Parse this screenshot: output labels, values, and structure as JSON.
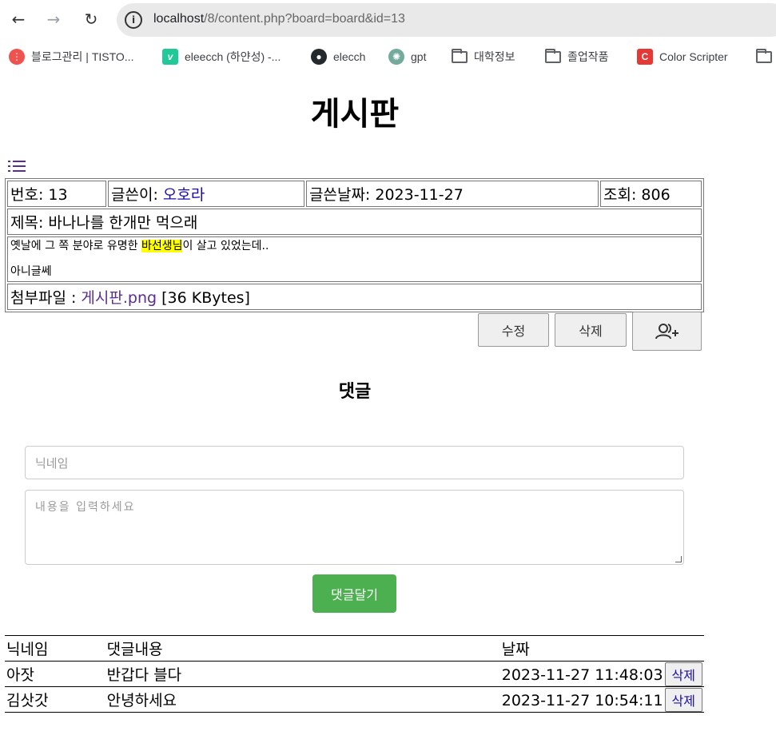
{
  "browser": {
    "url_host": "localhost",
    "url_path": "/8/content.php?board=board&id=13",
    "bookmarks": [
      {
        "label": "블로그관리 | TISTO...",
        "icon": "tistory-icon",
        "color": "#ef5350"
      },
      {
        "label": "eleecch (하얀성) -...",
        "icon": "velog-icon",
        "color": "#20c997"
      },
      {
        "label": "elecch",
        "icon": "github-icon",
        "color": "#24292e"
      },
      {
        "label": "gpt",
        "icon": "openai-icon",
        "color": "#74aa9c"
      },
      {
        "label": "대학정보",
        "icon": "folder-icon"
      },
      {
        "label": "졸업작품",
        "icon": "folder-icon"
      },
      {
        "label": "Color Scripter",
        "icon": "color-scripter-icon",
        "color": "#e53935"
      },
      {
        "label": "",
        "icon": "folder-icon"
      }
    ]
  },
  "page": {
    "title": "게시판"
  },
  "post": {
    "number_label": "번호:",
    "number": "13",
    "author_label": "글쓴이:",
    "author": "오호라",
    "date_label": "글쓴날짜:",
    "date": "2023-11-27",
    "views_label": "조회:",
    "views": "806",
    "subject_label": "제목:",
    "subject": "바나나를 한개만 먹으래",
    "content_before": "옛날에 그 쪽 분야로 유명한 ",
    "content_highlight": "바선생님",
    "content_after": "이 살고 있었는데..",
    "content_line2": "아니글쎄",
    "attach_label": "첨부파일 :",
    "attach_name": "게시판.png",
    "attach_size": "[36 KBytes]"
  },
  "actions": {
    "edit": "수정",
    "delete": "삭제"
  },
  "comments_section": {
    "title": "댓글",
    "nickname_placeholder": "닉네임",
    "content_placeholder": "내용을 입력하세요",
    "submit": "댓글달기",
    "headers": {
      "nickname": "닉네임",
      "content": "댓글내용",
      "date": "날짜"
    },
    "rows": [
      {
        "nickname": "아잣",
        "content": "반갑다 블다",
        "date": "2023-11-27 11:48:03",
        "delete": "삭제"
      },
      {
        "nickname": "김삿갓",
        "content": "안녕하세요",
        "date": "2023-11-27 10:54:11",
        "delete": "삭제"
      }
    ]
  }
}
